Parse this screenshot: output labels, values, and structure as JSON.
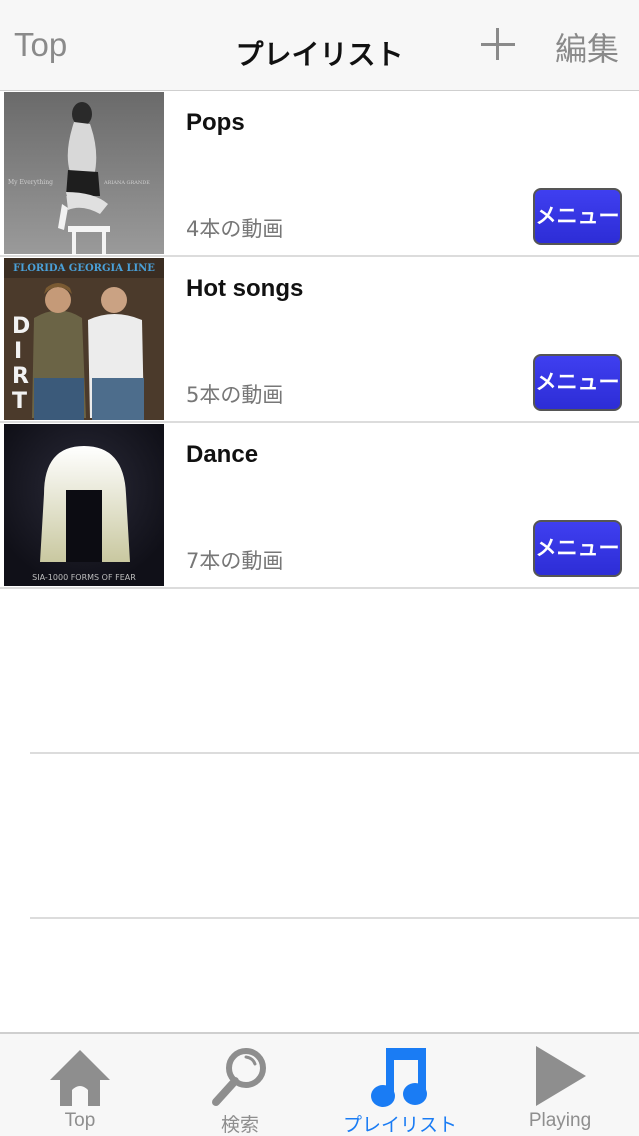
{
  "navbar": {
    "back_label": "Top",
    "title": "プレイリスト",
    "add_icon": "plus-icon",
    "edit_label": "編集"
  },
  "playlists": [
    {
      "title": "Pops",
      "count": "4本の動画",
      "menu_label": "メニュー",
      "artwork": "Ariana Grande - My Everything (grayscale)"
    },
    {
      "title": "Hot songs",
      "count": "5本の動画",
      "menu_label": "メニュー",
      "artwork": "Florida Georgia Line - DIRT"
    },
    {
      "title": "Dance",
      "count": "7本の動画",
      "menu_label": "メニュー",
      "artwork": "Sia - 1000 Forms of Fear"
    }
  ],
  "artwork_text": {
    "pops_left": "My Everything",
    "pops_right": "ARIANA GRANDE",
    "hot_band": "FLORIDA GEORGIA LINE",
    "hot_album": "DIRT",
    "dance_caption": "SIA-1000 FORMS OF FEAR"
  },
  "tabbar": {
    "active_color": "#1a7cf4",
    "inactive_color": "#8e8e8e",
    "tabs": [
      {
        "label": "Top",
        "icon": "home-icon",
        "active": false
      },
      {
        "label": "検索",
        "icon": "search-icon",
        "active": false
      },
      {
        "label": "プレイリスト",
        "icon": "music-note-icon",
        "active": true
      },
      {
        "label": "Playing",
        "icon": "play-icon",
        "active": false
      }
    ]
  },
  "colors": {
    "menu_button": "#3535e4",
    "separator": "#dcdcdc"
  }
}
